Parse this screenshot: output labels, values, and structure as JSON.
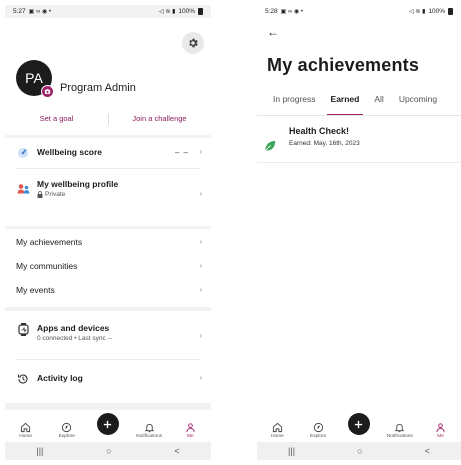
{
  "left_screen": {
    "status_bar": {
      "time": "5:27",
      "battery": "100%"
    },
    "profile": {
      "initials": "PA",
      "name": "Program Admin",
      "set_goal": "Set a goal",
      "join_challenge": "Join a challenge"
    },
    "wellbeing_score": {
      "label": "Wellbeing score",
      "value": "– –"
    },
    "wellbeing_profile": {
      "label": "My wellbeing profile",
      "privacy": "Private"
    },
    "menu": {
      "achievements": "My achievements",
      "communities": "My communities",
      "events": "My events"
    },
    "apps_devices": {
      "label": "Apps and devices",
      "status": "0 connected • Last sync --"
    },
    "activity_log": {
      "label": "Activity log"
    }
  },
  "right_screen": {
    "status_bar": {
      "time": "5:28",
      "battery": "100%"
    },
    "title": "My achievements",
    "tabs": [
      "In progress",
      "Earned",
      "All",
      "Upcoming"
    ],
    "active_tab": "Earned",
    "achievement": {
      "title": "Health Check!",
      "earned": "Earned: May, 16th, 2023"
    }
  },
  "bottom_nav": {
    "home": "Home",
    "explore": "Explore",
    "notifications": "Notifications",
    "me": "Me"
  },
  "system_nav": {
    "recents": "|||",
    "home": "○",
    "back": "<"
  },
  "colors": {
    "accent": "#a0246b",
    "background": "#f2f2f2",
    "card": "#ffffff",
    "score_icon": "#4a7fd1",
    "profile_icon": "#e2574c",
    "leaf_icon": "#3aa65a"
  }
}
